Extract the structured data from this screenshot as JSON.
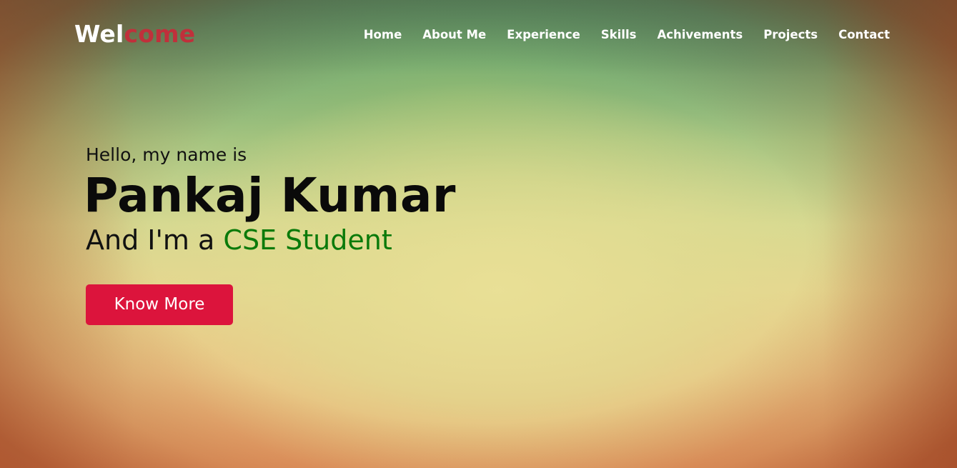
{
  "navbar": {
    "logo_part1": "Wel",
    "logo_part2": "come",
    "menu": [
      {
        "label": "Home"
      },
      {
        "label": "About Me"
      },
      {
        "label": "Experience"
      },
      {
        "label": "Skills"
      },
      {
        "label": "Achivements"
      },
      {
        "label": "Projects"
      },
      {
        "label": "Contact"
      }
    ]
  },
  "hero": {
    "greeting": "Hello, my name is",
    "name": "Pankaj Kumar",
    "role_prefix": "And I'm a ",
    "role": "CSE Student",
    "button_label": "Know More"
  },
  "colors": {
    "logo_accent": "#c0303b",
    "role_text": "#0a7a0a",
    "button_bg": "#dc143c",
    "nav_text": "#ffffff"
  }
}
